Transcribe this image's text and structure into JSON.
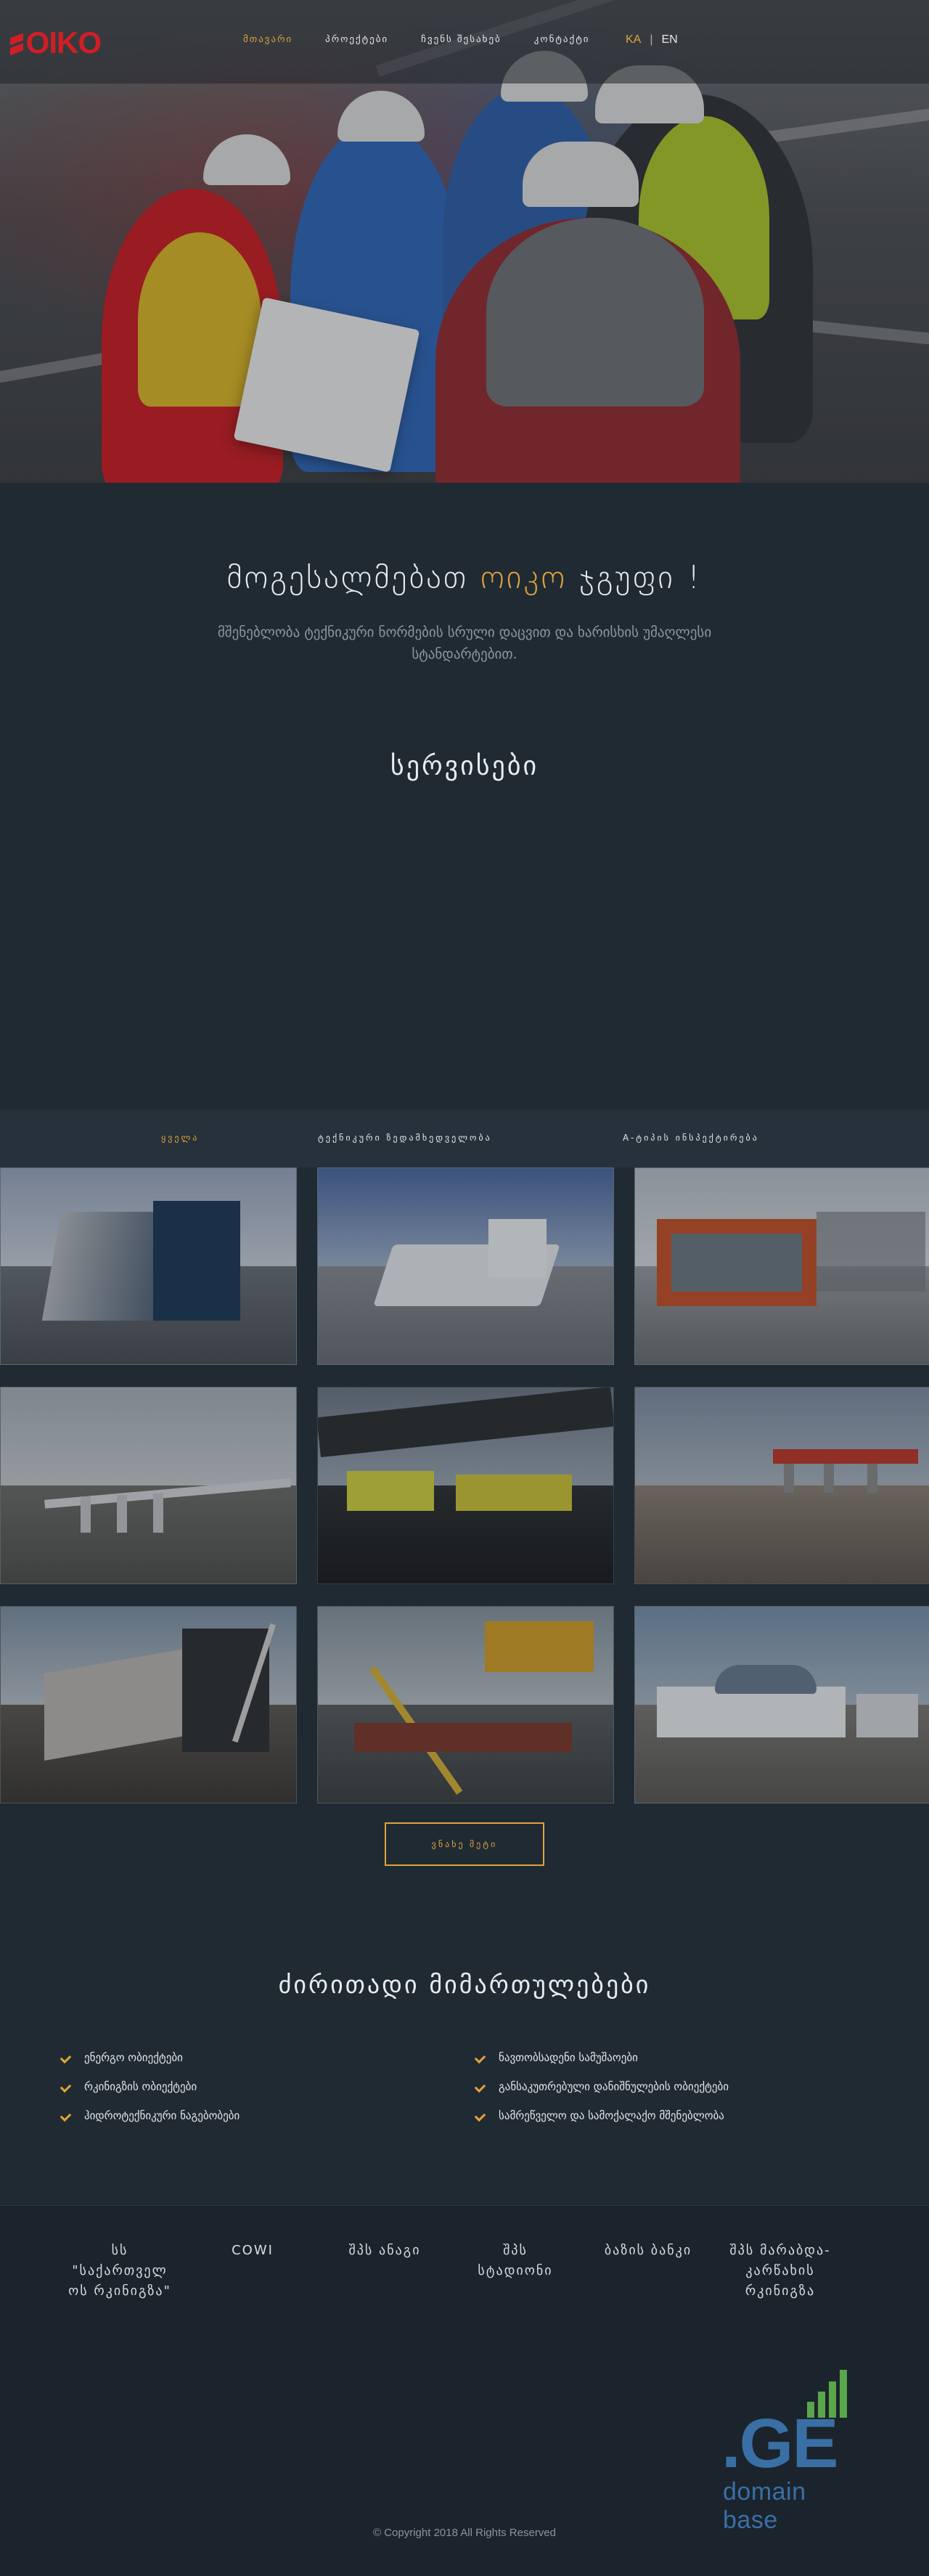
{
  "header": {
    "logo_text": "OIKO",
    "nav": [
      {
        "label": "მთავარი",
        "active": true
      },
      {
        "label": "პროექტები",
        "active": false
      },
      {
        "label": "ჩვენს შესახებ",
        "active": false
      },
      {
        "label": "კონტაქტი",
        "active": false
      }
    ],
    "lang": {
      "ka": "KA",
      "sep": "|",
      "en": "EN"
    }
  },
  "intro": {
    "welcome_prefix": "მოგესალმებათ",
    "welcome_accent": "ოიკო",
    "welcome_suffix": "ჯგუფი !",
    "subtitle_line1": "მშენებლობა ტექნიკური ნორმების სრული დაცვით და ხარისხის უმაღლესი",
    "subtitle_line2": "სტანდარტებით.",
    "services_title": "სერვისები"
  },
  "filters": {
    "items": [
      {
        "label": "ყველა",
        "active": true
      },
      {
        "label": "ტექნიკური ზედამხედველობა",
        "active": false
      },
      {
        "label": "A-ტიპის ინსპექტირება",
        "active": false
      }
    ]
  },
  "gallery": {
    "tiles": [
      {
        "name": "project-1",
        "theme": "glass-building"
      },
      {
        "name": "project-2",
        "theme": "white-arena"
      },
      {
        "name": "project-3",
        "theme": "red-canopy"
      },
      {
        "name": "project-4",
        "theme": "bridge-far"
      },
      {
        "name": "project-5",
        "theme": "under-bridge"
      },
      {
        "name": "project-6",
        "theme": "rail-bridge"
      },
      {
        "name": "project-7",
        "theme": "bridge-pier"
      },
      {
        "name": "project-8",
        "theme": "crane"
      },
      {
        "name": "project-9",
        "theme": "white-terminal"
      }
    ],
    "more_button": "ვნახე მეტი"
  },
  "directions": {
    "title": "ძირითადი მიმართულებები",
    "left": [
      "ენერგო ობიექტები",
      "რკინიგზის ობიექტები",
      "ჰიდროტექნიკური ნაგებობები"
    ],
    "right": [
      "ნავთობსადენი სამუშაოები",
      "განსაკუთრებული დანიშნულების ობიექტები",
      "სამრეწველო და სამოქალაქო მშენებლობა"
    ]
  },
  "footer": {
    "partners": [
      {
        "lines": [
          "სს",
          "\"საქართველ",
          "ოს რკინიგზა\""
        ]
      },
      {
        "lines": [
          "COWI"
        ]
      },
      {
        "lines": [
          "შპს ანაგი"
        ]
      },
      {
        "lines": [
          "შპს",
          "სტადიონი"
        ]
      },
      {
        "lines": [
          "ბაზის ბანკი"
        ]
      },
      {
        "lines": [
          "შპს მარაბდა-",
          "კარწახის",
          "რკინიგზა"
        ]
      }
    ],
    "ge_logo": {
      "mark": ".GE",
      "caption": "domain base"
    },
    "copyright": "© Copyright 2018 All Rights Reserved"
  },
  "colors": {
    "accent": "#e0a33a",
    "background": "#1f2a33",
    "brand_red": "#d11e26",
    "ge_blue": "#3a6fa6",
    "ge_green": "#5aa64a"
  },
  "icons": {
    "check": "check-icon"
  }
}
